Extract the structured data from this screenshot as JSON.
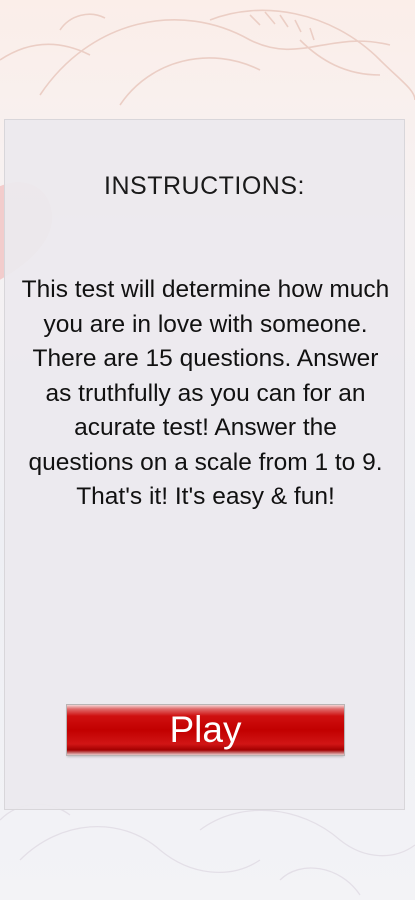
{
  "instructions": {
    "title": "INSTRUCTIONS:",
    "body": "This test will determine how much you are in love with someone. There are 15 questions. Answer as truthfully as you can for an acurate test! Answer the questions on a scale from 1 to 9. That's it! It's easy & fun!"
  },
  "play_button": {
    "label": "Play"
  },
  "colors": {
    "button_red": "#c20000",
    "panel_bg": "#eceaee",
    "heart_accent": "#f2c8c8"
  },
  "icons": {
    "background": "floral-line-art-icon",
    "heart": "heart-icon"
  }
}
